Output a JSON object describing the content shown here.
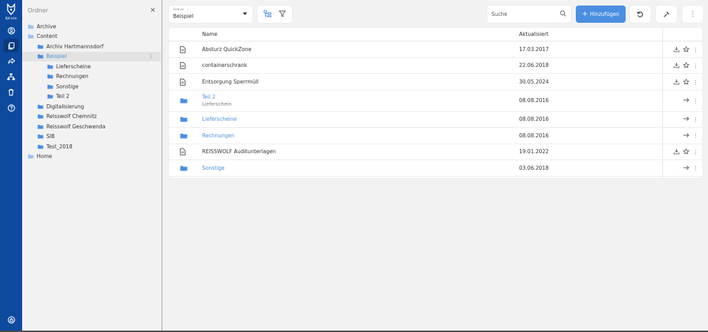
{
  "app": {
    "logo_text": "BJK tstle"
  },
  "nav_rail": {
    "items": [
      {
        "icon": "user-circle-icon",
        "active": false
      },
      {
        "icon": "documents-icon",
        "active": true
      },
      {
        "icon": "share-icon",
        "active": false
      },
      {
        "icon": "hierarchy-icon",
        "active": false
      },
      {
        "icon": "trash-icon",
        "active": false
      },
      {
        "icon": "help-icon",
        "active": false
      }
    ],
    "bottom_icon": "account-icon"
  },
  "sidebar": {
    "title": "Ordner",
    "close_icon": "close-icon",
    "tree": [
      {
        "label": "Archive",
        "level": 0
      },
      {
        "label": "Content",
        "level": 0
      },
      {
        "label": "Archiv Hartmannsdorf",
        "level": 1
      },
      {
        "label": "Beispiel",
        "level": 1,
        "selected": true
      },
      {
        "label": "Lieferscheine",
        "level": 2
      },
      {
        "label": "Rechnungen",
        "level": 2
      },
      {
        "label": "Sonstige",
        "level": 2
      },
      {
        "label": "Teil 2",
        "level": 2
      },
      {
        "label": "Digitalisierung",
        "level": 1
      },
      {
        "label": "Reisswolf Chemnitz",
        "level": 1
      },
      {
        "label": "Reisswolf Geschwenda",
        "level": 1
      },
      {
        "label": "SIB",
        "level": 1
      },
      {
        "label": "Test_2018",
        "level": 1
      },
      {
        "label": "Home",
        "level": 0
      }
    ]
  },
  "toolbar": {
    "folder_select": {
      "caption": "Ordner",
      "value": "Beispiel"
    },
    "search": {
      "placeholder": "Suche"
    },
    "add_label": "Hinzufügen"
  },
  "table": {
    "columns": {
      "name": "Name",
      "updated": "Aktualisiert"
    },
    "rows": [
      {
        "type": "file",
        "name": "Absturz QuickZone",
        "date": "17.03.2017"
      },
      {
        "type": "file",
        "name": "containerschrank",
        "date": "22.06.2018"
      },
      {
        "type": "file",
        "name": "Entsorgung Sperrmüll",
        "date": "30.05.2024"
      },
      {
        "type": "folder",
        "name": "Teil 2",
        "sub": "Lieferschein",
        "date": "08.08.2016"
      },
      {
        "type": "folder",
        "name": "Lieferscheine",
        "date": "08.08.2016"
      },
      {
        "type": "folder",
        "name": "Rechnungen",
        "date": "08.08.2016"
      },
      {
        "type": "file",
        "name": "REISSWOLF Auditunterlagen",
        "date": "19.01.2022"
      },
      {
        "type": "folder",
        "name": "Sonstige",
        "date": "03.06.2018"
      }
    ]
  },
  "colors": {
    "rail": "#0d4a9e",
    "accent": "#4a8fe2",
    "folder": "#4a90d9"
  }
}
